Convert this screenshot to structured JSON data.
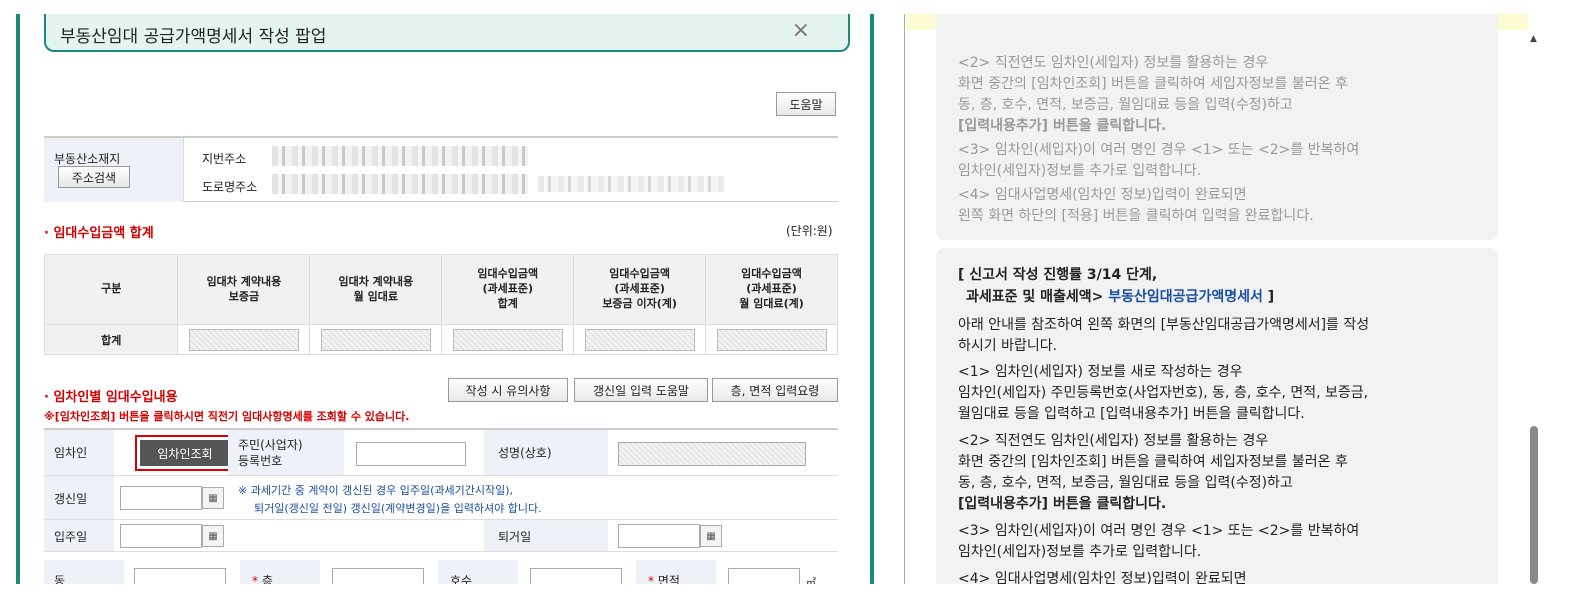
{
  "popup": {
    "title": "부동산임대 공급가액명세서 작성 팝업",
    "help_button": "도움말",
    "address": {
      "header_label": "부동산소재지",
      "search_button": "주소검색",
      "lot_label": "지번주소",
      "road_label": "도로명주소"
    },
    "sum_section": {
      "title": "· 임대수입금액 합계",
      "unit": "(단위:원)",
      "columns": [
        "구분",
        "임대차 계약내용\n보증금",
        "임대차 계약내용\n월 임대료",
        "임대수입금액\n(과세표준)\n합계",
        "임대수입금액\n(과세표준)\n보증금 이자(계)",
        "임대수입금액\n(과세표준)\n월 임대료(계)"
      ],
      "row_label": "합계"
    },
    "tenant_section": {
      "title": "· 임차인별 임대수입내용",
      "buttons": [
        "작성 시 유의사항",
        "갱신일 입력 도움말",
        "층, 면적 입력요령"
      ],
      "notice": "※[임차인조회] 버튼을 클릭하시면 직전기 임대사항명세를 조회할 수 있습니다.",
      "tenant_label": "임차인",
      "tenant_lookup_button": "임차인조회",
      "id_label_1": "주민(사업자)",
      "id_label_2": "등록번호",
      "name_label": "성명(상호)",
      "renewal_label": "갱신일",
      "renewal_note_1": "※ 과세기간 중 계약이 갱신된 경우 입주일(과세기간시작일),",
      "renewal_note_2": "퇴거일(갱신일 전일) 갱신일(계약변경일)을 입력하셔야 합니다.",
      "movein_label": "입주일",
      "moveout_label": "퇴거일",
      "dong_label": "동",
      "floor_label": "층",
      "unit_no_label": "호수",
      "area_label": "면적",
      "area_unit": "㎡",
      "required_mark": "*"
    }
  },
  "guide": {
    "top_cut_text": "입력내용추가 버튼을 클릭합니다.",
    "p1": [
      "<2> 직전연도 임차인(세입자) 정보를 활용하는 경우",
      "화면 중간의 [임차인조회] 버튼을 클릭하여 세입자정보를 불러온 후",
      "동, 층, 호수, 면적, 보증금, 월임대료 등을 입력(수정)하고",
      "[입력내용추가] 버튼을 클릭합니다.",
      "<3> 임차인(세입자)이 여러 명인 경우 <1> 또는 <2>를 반복하여",
      "임차인(세입자)정보를 추가로 입력합니다.",
      "<4> 임대사업명세(임차인 정보)입력이 완료되면",
      "왼쪽 화면 하단의 [적용] 버튼을 클릭하여 입력을 완료합니다."
    ],
    "p2_head_1": "[ 신고서 작성 진행률 3/14 단계,",
    "p2_head_2a": "과세표준 및 매출세액>",
    "p2_head_2b": "부동산임대공급가액명세서",
    "p2_head_2c": "]",
    "p2": [
      "아래 안내를 참조하여 왼쪽 화면의 [부동산임대공급가액명세서]를 작성",
      "하시기 바랍니다.",
      "<1> 임차인(세입자) 정보를 새로 작성하는 경우",
      "임차인(세입자) 주민등록번호(사업자번호), 동, 층, 호수, 면적, 보증금,",
      "월임대료 등을 입력하고 [입력내용추가] 버튼을 클릭합니다.",
      "<2> 직전연도 임차인(세입자) 정보를 활용하는 경우",
      "화면 중간의 [임차인조회] 버튼을 클릭하여 세입자정보를 불러온 후",
      "동, 층, 호수, 면적, 보증금, 월임대료 등을 입력(수정)하고",
      "[입력내용추가] 버튼을 클릭합니다.",
      "<3> 임차인(세입자)이 여러 명인 경우 <1> 또는 <2>를 반복하여",
      "임차인(세입자)정보를 추가로 입력합니다.",
      "<4> 임대사업명세(임차인 정보)입력이 완료되면"
    ]
  },
  "colors": {
    "accent": "#1a8a7a",
    "required": "#d40000",
    "link": "#1a4e9e"
  }
}
